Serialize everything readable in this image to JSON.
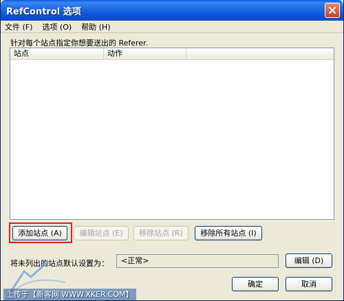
{
  "window": {
    "title": "RefControl 选项"
  },
  "menubar": {
    "items": [
      "文件 (F)",
      "选项 (O)",
      "帮助 (H)"
    ]
  },
  "instruction": "针对每个站点指定你想要送出的 Referer.",
  "list": {
    "columns": [
      "站点",
      "动作"
    ]
  },
  "buttons": {
    "add": "添加站点 (A)",
    "edit": "编辑站点 (E)",
    "remove": "移除站点 (R)",
    "remove_all": "移除所有站点 (I)",
    "edit_default": "编辑 (D)",
    "ok": "确定",
    "cancel": "取消"
  },
  "default": {
    "label": "将未列出的站点默认设置为：",
    "value": "<正常>"
  },
  "watermark": {
    "text": "上传于【新客网 WWW.XKER.COM】"
  },
  "colors": {
    "title_bar": "#0c55d8",
    "highlight": "#e02020",
    "dialog_bg": "#ece9d8"
  },
  "icons": {
    "close": "close-icon"
  }
}
